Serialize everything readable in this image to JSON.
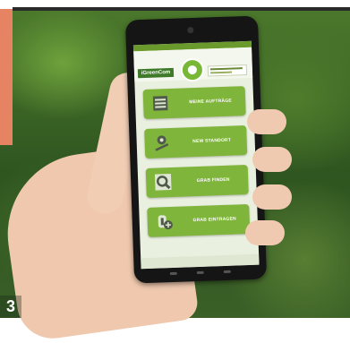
{
  "page_number": "3",
  "app": {
    "logo_left_text": "iGreenCom",
    "menu": [
      {
        "label": "MEINE AUFTRÄGE",
        "icon": "list-icon"
      },
      {
        "label": "NEW STANDORT",
        "icon": "location-pin-icon"
      },
      {
        "label": "GRAB FINDEN",
        "icon": "search-magnifier-icon"
      },
      {
        "label": "GRAB EINTRAGEN",
        "icon": "add-grave-icon"
      }
    ]
  },
  "colors": {
    "accent_orange": "#e58362",
    "app_green": "#7fb53a",
    "screen_bg": "#eaf0df"
  }
}
